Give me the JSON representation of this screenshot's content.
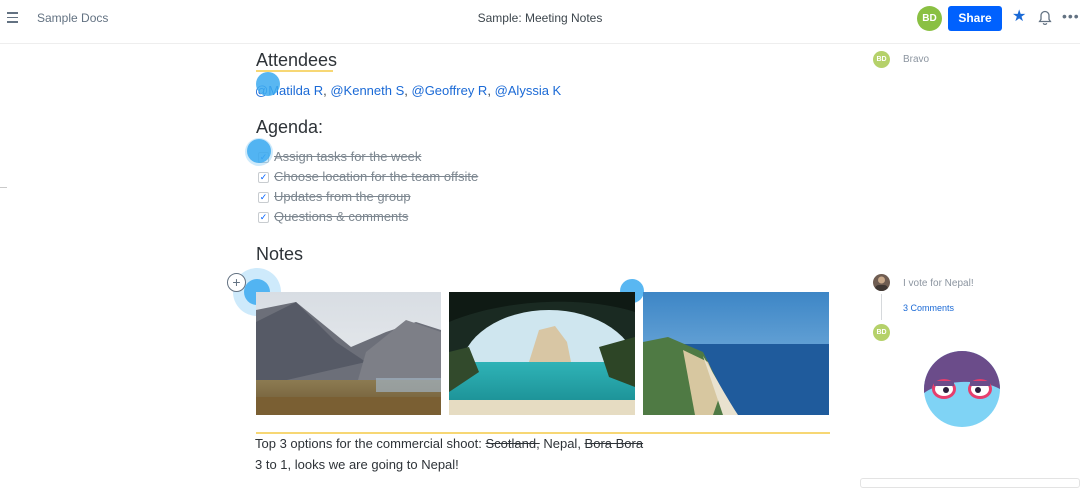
{
  "topbar": {
    "app_title": "Sample Docs",
    "doc_title": "Sample: Meeting Notes",
    "avatar_initials": "BD",
    "share_label": "Share",
    "more_label": "•••"
  },
  "doc": {
    "attendees_heading": "Attendees",
    "mentions": [
      "@Matilda R",
      "@Kenneth S",
      "@Geoffrey R",
      "@Alyssia K"
    ],
    "agenda_heading": "Agenda:",
    "agenda_items": [
      {
        "label": "Assign tasks for the week",
        "checked": true
      },
      {
        "label": "Choose location for the team offsite",
        "checked": true
      },
      {
        "label": "Updates from the group",
        "checked": true
      },
      {
        "label": "Questions & comments",
        "checked": true
      }
    ],
    "notes_heading": "Notes",
    "options_prefix": "Top 3 options for the commercial shoot: ",
    "option_1": "Scotland,",
    "option_2": "Nepal",
    "option_sep": ", ",
    "option_3": "Bora Bora",
    "result_line": "3 to 1, looks we are going to Nepal!"
  },
  "sidebar": {
    "bravo_avatar": "BD",
    "bravo_label": "Bravo",
    "comment_text": "I vote for Nepal!",
    "comments_link": "3 Comments",
    "reply_avatar": "BD"
  },
  "colors": {
    "accent": "#0061fe",
    "link": "#1b6ad6",
    "highlight": "#f7d774",
    "avatar_green": "#8ac043"
  }
}
